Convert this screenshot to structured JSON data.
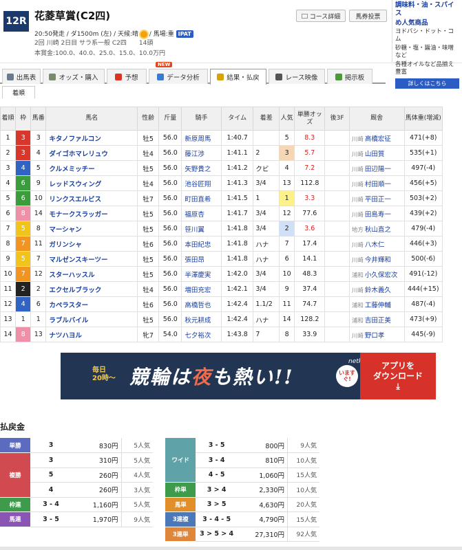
{
  "race": {
    "number": "12R",
    "name": "花菱草賞(C2四)",
    "line1_pre": "20:50発走 / ダ1500m (左) / 天候:晴",
    "line1_post": "/ 馬場:重",
    "ipat": "IPAT",
    "line2": "2回 川崎 2日目 サラ系一般 C2四　　14頭",
    "line3": "本賞金:100.0、40.0、25.0、15.0、10.0万円"
  },
  "header_buttons": {
    "course": "コース詳細",
    "vote": "馬券投票"
  },
  "ad": {
    "title1": "調味料・油・スパイス",
    "title2": "め人気商品",
    "body1": "ヨドバシ・ドット・コム",
    "body2": "砂糖・塩・醤油・味噌など",
    "body3": "各種オイルなど品揃え豊富",
    "button": "詳しくはこちら"
  },
  "tabs": [
    {
      "label": "出馬表",
      "icon": "table-icon",
      "color": "#6b7a8c"
    },
    {
      "label": "オッズ・購入",
      "icon": "odds-icon",
      "color": "#7a8a6a"
    },
    {
      "label": "予想",
      "icon": "target-icon",
      "color": "#d32"
    },
    {
      "label": "データ分析",
      "icon": "chart-icon",
      "color": "#3a7ad0"
    },
    {
      "label": "結果・払戻",
      "icon": "coins-icon",
      "color": "#d9a400"
    },
    {
      "label": "レース映像",
      "icon": "film-icon",
      "color": "#555"
    },
    {
      "label": "掲示板",
      "icon": "chat-icon",
      "color": "#4a9a3a"
    }
  ],
  "new_badge": "NEW",
  "subtab": "着順",
  "table_headers": [
    "着順",
    "枠",
    "馬番",
    "馬名",
    "性齢",
    "斤量",
    "騎手",
    "タイム",
    "着差",
    "人気",
    "単勝オッズ",
    "後3F",
    "厩舎",
    "馬体重(増減)"
  ],
  "results": [
    {
      "rank": "1",
      "frame": "3",
      "no": "3",
      "horse": "キタノファルコン",
      "sexage": "牡5",
      "weight": "56.0",
      "jockey": "新原周馬",
      "time": "1:40.7",
      "margin": "",
      "pop": "5",
      "odds": "8.3",
      "last3f": "",
      "aff": "川崎",
      "trainer": "高橋宏征",
      "body": "471(+8)"
    },
    {
      "rank": "2",
      "frame": "3",
      "no": "4",
      "horse": "ダイゴホマレリュウ",
      "sexage": "牡4",
      "weight": "56.0",
      "jockey": "藤江渉",
      "time": "1:41.1",
      "margin": "2",
      "pop": "3",
      "odds": "5.7",
      "last3f": "",
      "aff": "川崎",
      "trainer": "山田質",
      "body": "535(+1)"
    },
    {
      "rank": "3",
      "frame": "4",
      "no": "5",
      "horse": "クルメミッチー",
      "sexage": "牡5",
      "weight": "56.0",
      "jockey": "矢野貴之",
      "time": "1:41.2",
      "margin": "クビ",
      "pop": "4",
      "odds": "7.2",
      "last3f": "",
      "aff": "川崎",
      "trainer": "田辺陽一",
      "body": "497(-4)"
    },
    {
      "rank": "4",
      "frame": "6",
      "no": "9",
      "horse": "レッドスウィング",
      "sexage": "牡4",
      "weight": "56.0",
      "jockey": "池谷匠翔",
      "time": "1:41.3",
      "margin": "3/4",
      "pop": "13",
      "odds": "112.8",
      "last3f": "",
      "aff": "川崎",
      "trainer": "村田順一",
      "body": "456(+5)"
    },
    {
      "rank": "5",
      "frame": "6",
      "no": "10",
      "horse": "リンクスエルビス",
      "sexage": "牡7",
      "weight": "56.0",
      "jockey": "町田直希",
      "time": "1:41.5",
      "margin": "1",
      "pop": "1",
      "odds": "3.3",
      "last3f": "",
      "aff": "川崎",
      "trainer": "平田正一",
      "body": "503(+2)"
    },
    {
      "rank": "6",
      "frame": "8",
      "no": "14",
      "horse": "モナークスラッガー",
      "sexage": "牡5",
      "weight": "56.0",
      "jockey": "福原杏",
      "time": "1:41.7",
      "margin": "3/4",
      "pop": "12",
      "odds": "77.6",
      "last3f": "",
      "aff": "川崎",
      "trainer": "田島寿一",
      "body": "439(+2)"
    },
    {
      "rank": "7",
      "frame": "5",
      "no": "8",
      "horse": "マーシャン",
      "sexage": "牡5",
      "weight": "56.0",
      "jockey": "笹川翼",
      "time": "1:41.8",
      "margin": "3/4",
      "pop": "2",
      "odds": "3.6",
      "last3f": "",
      "aff": "地方",
      "trainer": "秋山直之",
      "body": "479(-4)"
    },
    {
      "rank": "8",
      "frame": "7",
      "no": "11",
      "horse": "ガリンシャ",
      "sexage": "牡6",
      "weight": "56.0",
      "jockey": "本田紀忠",
      "time": "1:41.8",
      "margin": "ハナ",
      "pop": "7",
      "odds": "17.4",
      "last3f": "",
      "aff": "川崎",
      "trainer": "八木仁",
      "body": "446(+3)"
    },
    {
      "rank": "9",
      "frame": "5",
      "no": "7",
      "horse": "マルゼンスキーツー",
      "sexage": "牡5",
      "weight": "56.0",
      "jockey": "張田昂",
      "time": "1:41.8",
      "margin": "ハナ",
      "pop": "6",
      "odds": "14.1",
      "last3f": "",
      "aff": "川崎",
      "trainer": "今井輝和",
      "body": "500(-6)"
    },
    {
      "rank": "10",
      "frame": "7",
      "no": "12",
      "horse": "スターハッスル",
      "sexage": "牡5",
      "weight": "56.0",
      "jockey": "半澤慶実",
      "time": "1:42.0",
      "margin": "3/4",
      "pop": "10",
      "odds": "48.3",
      "last3f": "",
      "aff": "浦和",
      "trainer": "小久保宏次",
      "body": "491(-12)"
    },
    {
      "rank": "11",
      "frame": "2",
      "no": "2",
      "horse": "エクセルブラック",
      "sexage": "牡4",
      "weight": "56.0",
      "jockey": "増田充宏",
      "time": "1:42.1",
      "margin": "3/4",
      "pop": "9",
      "odds": "37.4",
      "last3f": "",
      "aff": "川崎",
      "trainer": "鈴木義久",
      "body": "444(+15)"
    },
    {
      "rank": "12",
      "frame": "4",
      "no": "6",
      "horse": "カペラスター",
      "sexage": "牡6",
      "weight": "56.0",
      "jockey": "高橋哲也",
      "time": "1:42.4",
      "margin": "1.1/2",
      "pop": "11",
      "odds": "74.7",
      "last3f": "",
      "aff": "浦和",
      "trainer": "工藤伸輔",
      "body": "487(-4)"
    },
    {
      "rank": "13",
      "frame": "1",
      "no": "1",
      "horse": "ラブルバイル",
      "sexage": "牡5",
      "weight": "56.0",
      "jockey": "秋元耕成",
      "time": "1:42.4",
      "margin": "ハナ",
      "pop": "14",
      "odds": "128.2",
      "last3f": "",
      "aff": "浦和",
      "trainer": "吉田正美",
      "body": "473(+9)"
    },
    {
      "rank": "14",
      "frame": "8",
      "no": "13",
      "horse": "ナツハヨル",
      "sexage": "牝7",
      "weight": "54.0",
      "jockey": "七夕裕次",
      "time": "1:43.8",
      "margin": "7",
      "pop": "8",
      "odds": "33.9",
      "last3f": "",
      "aff": "川崎",
      "trainer": "野口孝",
      "body": "445(-9)"
    }
  ],
  "frame_colors": {
    "1": "#ffffff",
    "2": "#222222",
    "3": "#d9362c",
    "4": "#2f63c4",
    "5": "#f0c419",
    "6": "#3a9c3a",
    "7": "#f29520",
    "8": "#f08fa8"
  },
  "frame_text": {
    "1": "#222",
    "2": "#fff",
    "3": "#fff",
    "4": "#fff",
    "5": "#fff",
    "6": "#fff",
    "7": "#fff",
    "8": "#fff"
  },
  "banner": {
    "day1": "毎日",
    "day2": "20時～",
    "text_a": "競輪は",
    "text_b": "夜",
    "text_c": "も熱い",
    "text_d": "!!",
    "logo": "netkeirin",
    "now": "いますぐ!",
    "cta1": "アプリを",
    "cta2": "ダウンロード"
  },
  "payout_title": "払戻金",
  "payouts_left": [
    {
      "type": "単勝",
      "color": "#5b6bbf",
      "rows": [
        {
          "combo": "3",
          "yen": "830円",
          "pop": "5人気"
        }
      ]
    },
    {
      "type": "複勝",
      "color": "#d04a50",
      "rows": [
        {
          "combo": "3",
          "yen": "310円",
          "pop": "5人気"
        },
        {
          "combo": "5",
          "yen": "260円",
          "pop": "4人気"
        },
        {
          "combo": "4",
          "yen": "260円",
          "pop": "3人気"
        }
      ]
    },
    {
      "type": "枠連",
      "color": "#3f9b4c",
      "rows": [
        {
          "combo": "3 - 4",
          "yen": "1,160円",
          "pop": "5人気"
        }
      ]
    },
    {
      "type": "馬連",
      "color": "#8b55b5",
      "rows": [
        {
          "combo": "3 - 5",
          "yen": "1,970円",
          "pop": "9人気"
        }
      ]
    }
  ],
  "payouts_right": [
    {
      "type": "ワイド",
      "color": "#5fa3a8",
      "rows": [
        {
          "combo": "3 - 5",
          "yen": "800円",
          "pop": "9人気"
        },
        {
          "combo": "3 - 4",
          "yen": "810円",
          "pop": "10人気"
        },
        {
          "combo": "4 - 5",
          "yen": "1,060円",
          "pop": "15人気"
        }
      ]
    },
    {
      "type": "枠単",
      "color": "#3f9b4c",
      "rows": [
        {
          "combo": "3 > 4",
          "yen": "2,330円",
          "pop": "10人気"
        }
      ]
    },
    {
      "type": "馬単",
      "color": "#e08f2a",
      "rows": [
        {
          "combo": "3 > 5",
          "yen": "4,630円",
          "pop": "20人気"
        }
      ]
    },
    {
      "type": "3連複",
      "color": "#4a78b8",
      "rows": [
        {
          "combo": "3 - 4 - 5",
          "yen": "4,790円",
          "pop": "15人気"
        }
      ]
    },
    {
      "type": "3連単",
      "color": "#e0863a",
      "rows": [
        {
          "combo": "3 > 5 > 4",
          "yen": "27,310円",
          "pop": "92人気"
        }
      ]
    }
  ]
}
